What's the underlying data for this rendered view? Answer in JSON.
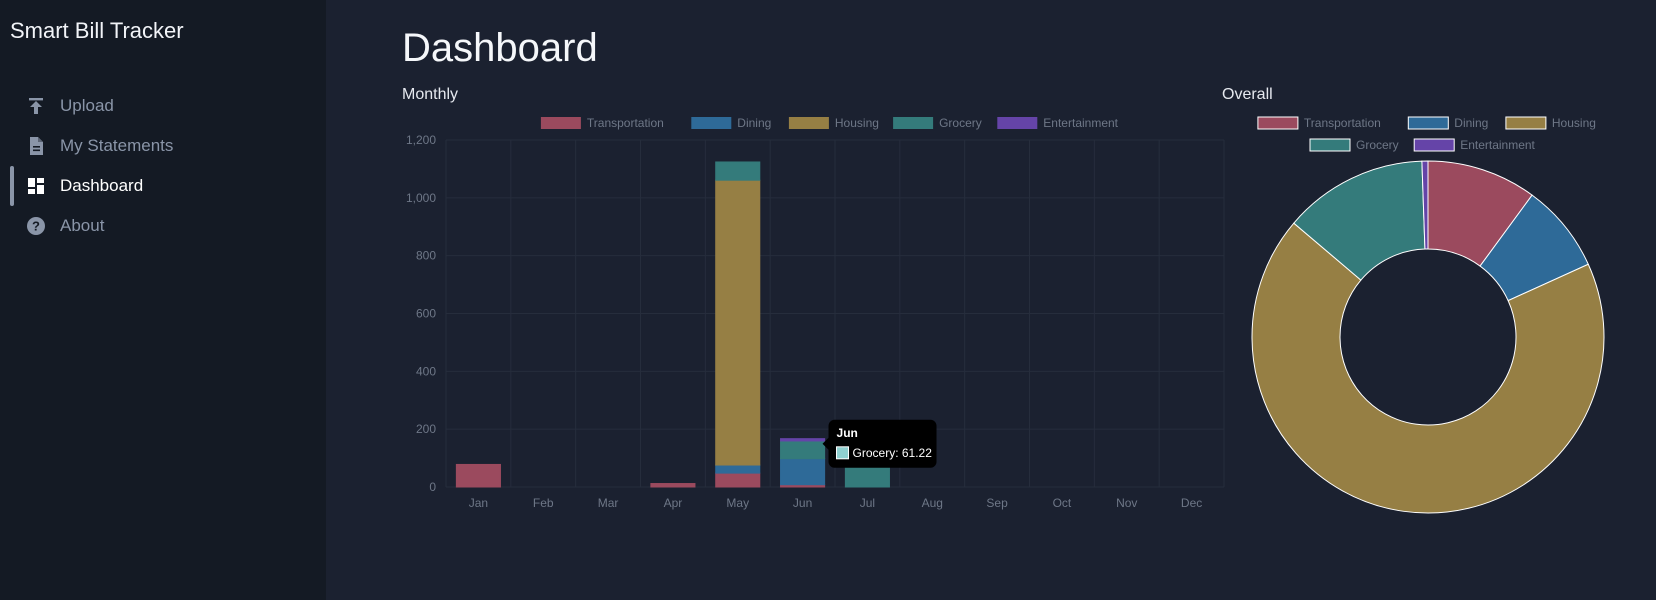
{
  "app": {
    "title": "Smart Bill Tracker"
  },
  "sidebar": {
    "items": [
      {
        "label": "Upload",
        "icon": "upload-icon",
        "active": false
      },
      {
        "label": "My Statements",
        "icon": "document-icon",
        "active": false
      },
      {
        "label": "Dashboard",
        "icon": "dashboard-icon",
        "active": true
      },
      {
        "label": "About",
        "icon": "help-icon",
        "active": false
      }
    ]
  },
  "main": {
    "title": "Dashboard",
    "monthly_label": "Monthly",
    "overall_label": "Overall"
  },
  "colors": {
    "Transportation": "#9b4a5e",
    "Dining": "#2e6a98",
    "Housing": "#967f44",
    "Grocery": "#347b7b",
    "Entertainment": "#6544a8",
    "grid": "#262d3c",
    "tick": "#6e7787"
  },
  "chart_data": [
    {
      "type": "bar",
      "stacked": true,
      "title": "",
      "categories": [
        "Jan",
        "Feb",
        "Mar",
        "Apr",
        "May",
        "Jun",
        "Jul",
        "Aug",
        "Sep",
        "Oct",
        "Nov",
        "Dec"
      ],
      "ylim": [
        0,
        1200
      ],
      "yticks": [
        0,
        200,
        400,
        600,
        800,
        1000,
        1200
      ],
      "ytick_labels": [
        "0",
        "200",
        "400",
        "600",
        "800",
        "1,000",
        "1,200"
      ],
      "grid": true,
      "legend": "top",
      "series": [
        {
          "name": "Transportation",
          "values": [
            78,
            0,
            0,
            12,
            48,
            8,
            0,
            0,
            0,
            0,
            0,
            0
          ]
        },
        {
          "name": "Dining",
          "values": [
            0,
            0,
            0,
            0,
            28,
            90,
            0,
            0,
            0,
            0,
            0,
            0
          ]
        },
        {
          "name": "Housing",
          "values": [
            0,
            0,
            0,
            0,
            985,
            0,
            0,
            0,
            0,
            0,
            0,
            0
          ]
        },
        {
          "name": "Grocery",
          "values": [
            0,
            0,
            0,
            0,
            63,
            61.22,
            68,
            0,
            0,
            0,
            0,
            0
          ]
        },
        {
          "name": "Entertainment",
          "values": [
            0,
            0,
            0,
            0,
            0,
            8,
            0,
            0,
            0,
            0,
            0,
            0
          ]
        }
      ],
      "tooltip": {
        "title": "Jun",
        "label": "Grocery: 61.22",
        "series": "Grocery",
        "category": "Jun"
      }
    },
    {
      "type": "pie",
      "donut": true,
      "title": "",
      "legend": "top",
      "labels": [
        "Transportation",
        "Dining",
        "Housing",
        "Grocery",
        "Entertainment"
      ],
      "values": [
        146,
        118,
        985,
        192,
        8
      ]
    }
  ]
}
